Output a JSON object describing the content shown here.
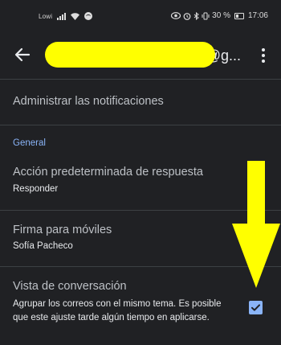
{
  "status_bar": {
    "carrier": "Lowi",
    "battery_percent": "30 %",
    "time": "17:06"
  },
  "app_bar": {
    "account_suffix": "@g...",
    "back_icon": "arrow-back-icon",
    "menu_icon": "more-vert-icon"
  },
  "settings": {
    "manage_notifications": "Administrar las notificaciones",
    "section_general": "General",
    "default_reply": {
      "title": "Acción predeterminada de respuesta",
      "value": "Responder"
    },
    "mobile_signature": {
      "title": "Firma para móviles",
      "value": "Sofía Pacheco"
    },
    "conversation_view": {
      "title": "Vista de conversación",
      "description": "Agrupar los correos con el mismo tema. Es posible que este ajuste tarde algún tiempo en aplicarse.",
      "checked": true
    }
  },
  "colors": {
    "background": "#202124",
    "accent": "#8ab4f8",
    "redaction": "#ffff00",
    "annotation": "#ffff00"
  }
}
